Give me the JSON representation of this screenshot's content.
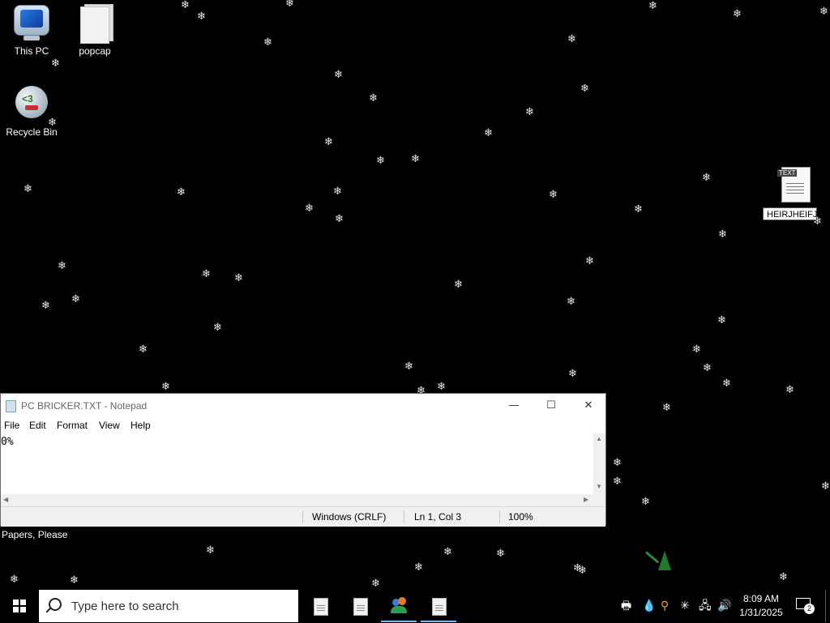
{
  "desktop": {
    "icons": [
      {
        "label": "This PC",
        "icon": "this-pc-icon"
      },
      {
        "label": "popcap",
        "icon": "folder-icon"
      },
      {
        "label": "Recycle Bin",
        "icon": "recycle-bin-icon"
      }
    ],
    "text_file": {
      "tag": "TEXT",
      "rename_value": "HEIRJHEIFJ"
    },
    "caption": "Papers, Please"
  },
  "notepad": {
    "title": "PC BRICKER.TXT - Notepad",
    "minimize": "—",
    "maximize": "☐",
    "close": "✕",
    "menu": [
      "File",
      "Edit",
      "Format",
      "View",
      "Help"
    ],
    "content": "0%",
    "status": {
      "encoding": "Windows (CRLF)",
      "position": "Ln 1, Col 3",
      "zoom": "100%"
    }
  },
  "taskbar": {
    "search_placeholder": "Type here to search",
    "clock_time": "8:09 AM",
    "clock_date": "1/31/2025",
    "notification_count": "2",
    "tray_icons": [
      "printer-icon",
      "water-drop-icon",
      "search-tool-icon",
      "settings-burst-icon",
      "network-icon",
      "volume-icon"
    ]
  },
  "colors": {
    "desktop_background": "#000000",
    "taskbar_accent": "#76b9ed"
  }
}
